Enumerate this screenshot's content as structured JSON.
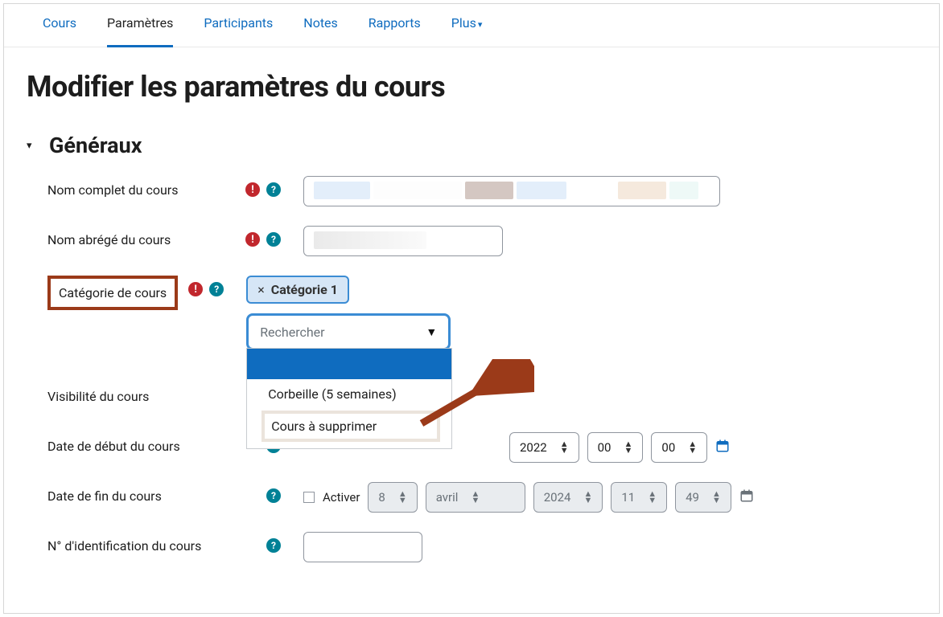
{
  "tabs": {
    "cours": "Cours",
    "parametres": "Paramètres",
    "participants": "Participants",
    "notes": "Notes",
    "rapports": "Rapports",
    "plus": "Plus"
  },
  "page_title": "Modifier les paramètres du cours",
  "section": "Généraux",
  "fields": {
    "fullname": {
      "label": "Nom complet du cours"
    },
    "shortname": {
      "label": "Nom abrégé du cours"
    },
    "category": {
      "label": "Catégorie de cours",
      "chip": "Catégorie 1",
      "search_placeholder": "Rechercher",
      "options": {
        "blank": " ",
        "corbeille": "Corbeille (5 semaines)",
        "supprimer": "Cours à supprimer"
      }
    },
    "visibility": {
      "label": "Visibilité du cours"
    },
    "startdate": {
      "label": "Date de début du cours",
      "year": "2022",
      "hour": "00",
      "minute": "00"
    },
    "enddate": {
      "label": "Date de fin du cours",
      "activer": "Activer",
      "day": "8",
      "month": "avril",
      "year": "2024",
      "hour": "11",
      "minute": "49"
    },
    "idnumber": {
      "label": "N° d'identification du cours"
    }
  }
}
